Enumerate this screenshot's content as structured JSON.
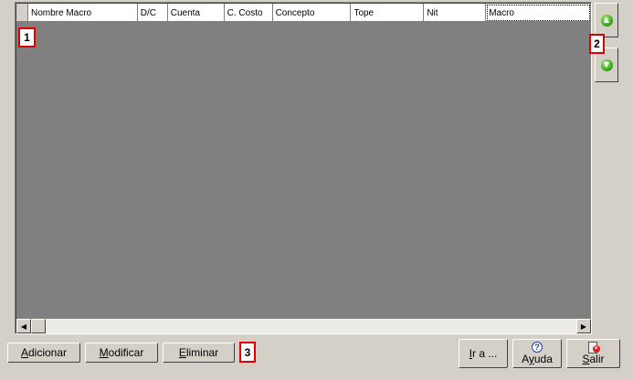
{
  "grid": {
    "columns": [
      "",
      "Nombre Macro",
      "D/C",
      "Cuenta",
      "C. Costo",
      "Concepto",
      "Tope",
      "Nit",
      "Macro"
    ]
  },
  "side_buttons": [
    {
      "icon": "green-up-arrow-icon",
      "glyph": "▲"
    },
    {
      "icon": "green-down-arrow-icon",
      "glyph": "▼"
    }
  ],
  "toolbar": {
    "add_label_u": "A",
    "add_label_rest": "dicionar",
    "modify_label_u": "M",
    "modify_label_rest": "odificar",
    "delete_label_u": "E",
    "delete_label_rest": "liminar",
    "goto_label_u": "I",
    "goto_label_rest": "r a ...",
    "help_label_pre": "A",
    "help_label_u": "y",
    "help_label_rest": "uda",
    "exit_label_u": "S",
    "exit_label_rest": "alir"
  },
  "markers": [
    "1",
    "2",
    "3"
  ],
  "scroll": {
    "left_glyph": "◀",
    "right_glyph": "▶"
  }
}
